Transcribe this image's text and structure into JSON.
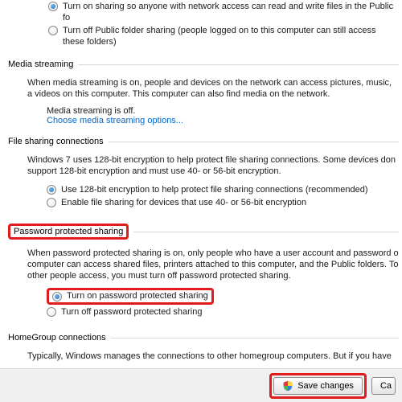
{
  "public_folder": {
    "on": "Turn on sharing so anyone with network access can read and write files in the Public fo",
    "off": "Turn off Public folder sharing (people logged on to this computer can still access these folders)"
  },
  "media": {
    "header": "Media streaming",
    "desc": "When media streaming is on, people and devices on the network can access pictures, music, a videos on this computer. This computer can also find media on the network.",
    "status": "Media streaming is off.",
    "link": "Choose media streaming options..."
  },
  "fileshare": {
    "header": "File sharing connections",
    "desc": "Windows 7 uses 128-bit encryption to help protect file sharing connections. Some devices don support 128-bit encryption and must use 40- or 56-bit encryption.",
    "opt128": "Use 128-bit encryption to help protect file sharing connections (recommended)",
    "opt40": "Enable file sharing for devices that use 40- or 56-bit encryption"
  },
  "password": {
    "header": "Password protected sharing",
    "desc": "When password protected sharing is on, only people who have a user account and password o computer can access shared files, printers attached to this computer, and the Public folders. To other people access, you must turn off password protected sharing.",
    "on": "Turn on password protected sharing",
    "off": "Turn off password protected sharing"
  },
  "homegroup": {
    "header": "HomeGroup connections",
    "desc": "Typically, Windows manages the connections to other homegroup computers. But if you have"
  },
  "buttons": {
    "save": "Save changes",
    "cancel": "Ca"
  }
}
